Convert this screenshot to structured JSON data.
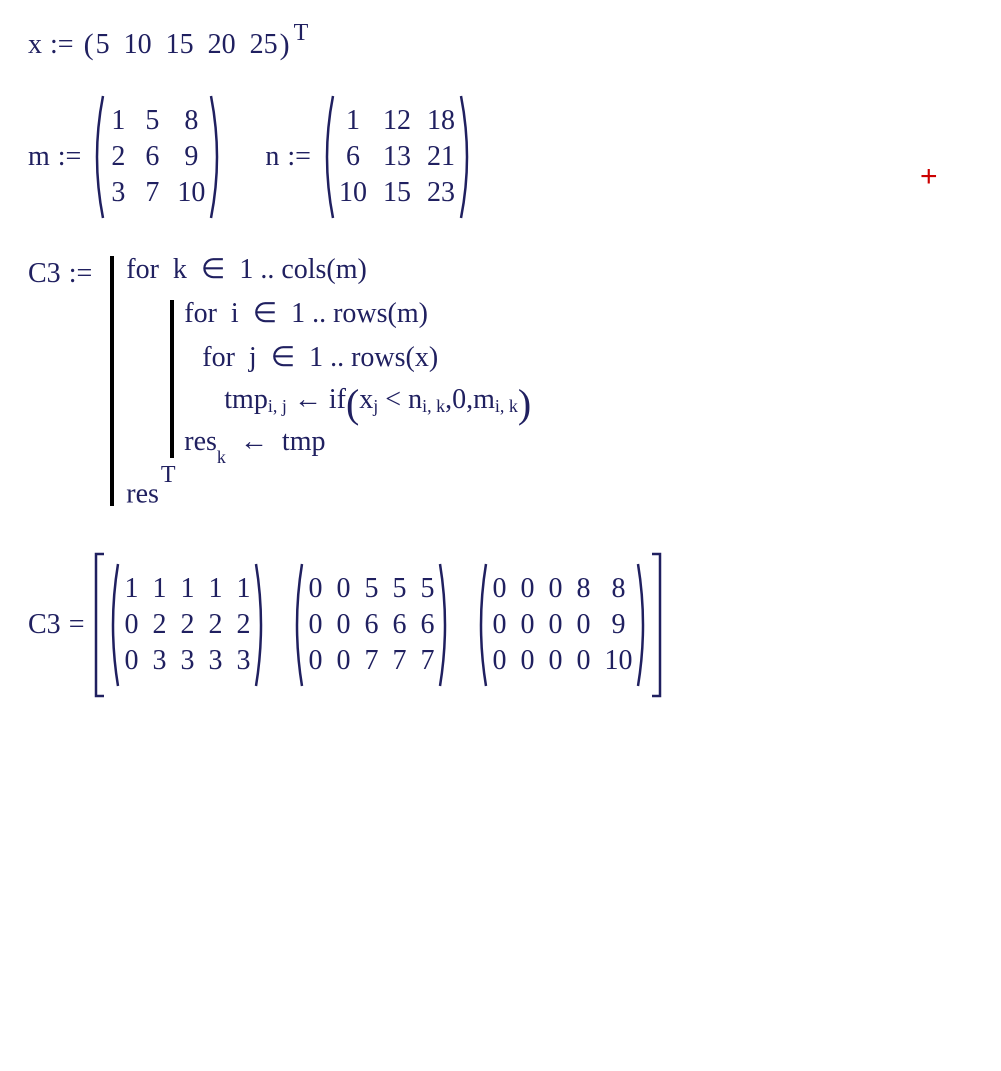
{
  "x_def": {
    "var": "x",
    "op": ":=",
    "values": [
      "5",
      "10",
      "15",
      "20",
      "25"
    ],
    "transpose": "T"
  },
  "m_def": {
    "var": "m",
    "op": ":=",
    "rows": [
      [
        "1",
        "5",
        "8"
      ],
      [
        "2",
        "6",
        "9"
      ],
      [
        "3",
        "7",
        "10"
      ]
    ]
  },
  "n_def": {
    "var": "n",
    "op": ":=",
    "rows": [
      [
        "1",
        "12",
        "18"
      ],
      [
        "6",
        "13",
        "21"
      ],
      [
        "10",
        "15",
        "23"
      ]
    ]
  },
  "prog": {
    "var": "C3",
    "op": ":=",
    "l1": {
      "kw": "for",
      "v": "k",
      "in": "∈",
      "range": "1 .. cols(m)"
    },
    "l2": {
      "kw": "for",
      "v": "i",
      "in": "∈",
      "range": "1 .. rows(m)"
    },
    "l3": {
      "kw": "for",
      "v": "j",
      "in": "∈",
      "range": "1 .. rows(x)"
    },
    "l4": {
      "lhs": "tmp",
      "sub": "i, j",
      "arrow": "←",
      "fn": "if",
      "arg_x": "x",
      "arg_xsub": "j",
      "lt": "<",
      "arg_n": "n",
      "arg_nsub": "i, k",
      "zero": "0",
      "arg_m": "m",
      "arg_msub": "i, k"
    },
    "l5": {
      "lhs": "res",
      "sub": "k",
      "arrow": "←",
      "rhs": "tmp"
    },
    "l6": {
      "txt": "res",
      "sup": "T"
    }
  },
  "result": {
    "var": "C3",
    "op": "=",
    "mats": [
      [
        [
          "1",
          "1",
          "1",
          "1",
          "1"
        ],
        [
          "0",
          "2",
          "2",
          "2",
          "2"
        ],
        [
          "0",
          "3",
          "3",
          "3",
          "3"
        ]
      ],
      [
        [
          "0",
          "0",
          "5",
          "5",
          "5"
        ],
        [
          "0",
          "0",
          "6",
          "6",
          "6"
        ],
        [
          "0",
          "0",
          "7",
          "7",
          "7"
        ]
      ],
      [
        [
          "0",
          "0",
          "0",
          "8",
          "8"
        ],
        [
          "0",
          "0",
          "0",
          "0",
          "9"
        ],
        [
          "0",
          "0",
          "0",
          "0",
          "10"
        ]
      ]
    ]
  },
  "plus": "+"
}
